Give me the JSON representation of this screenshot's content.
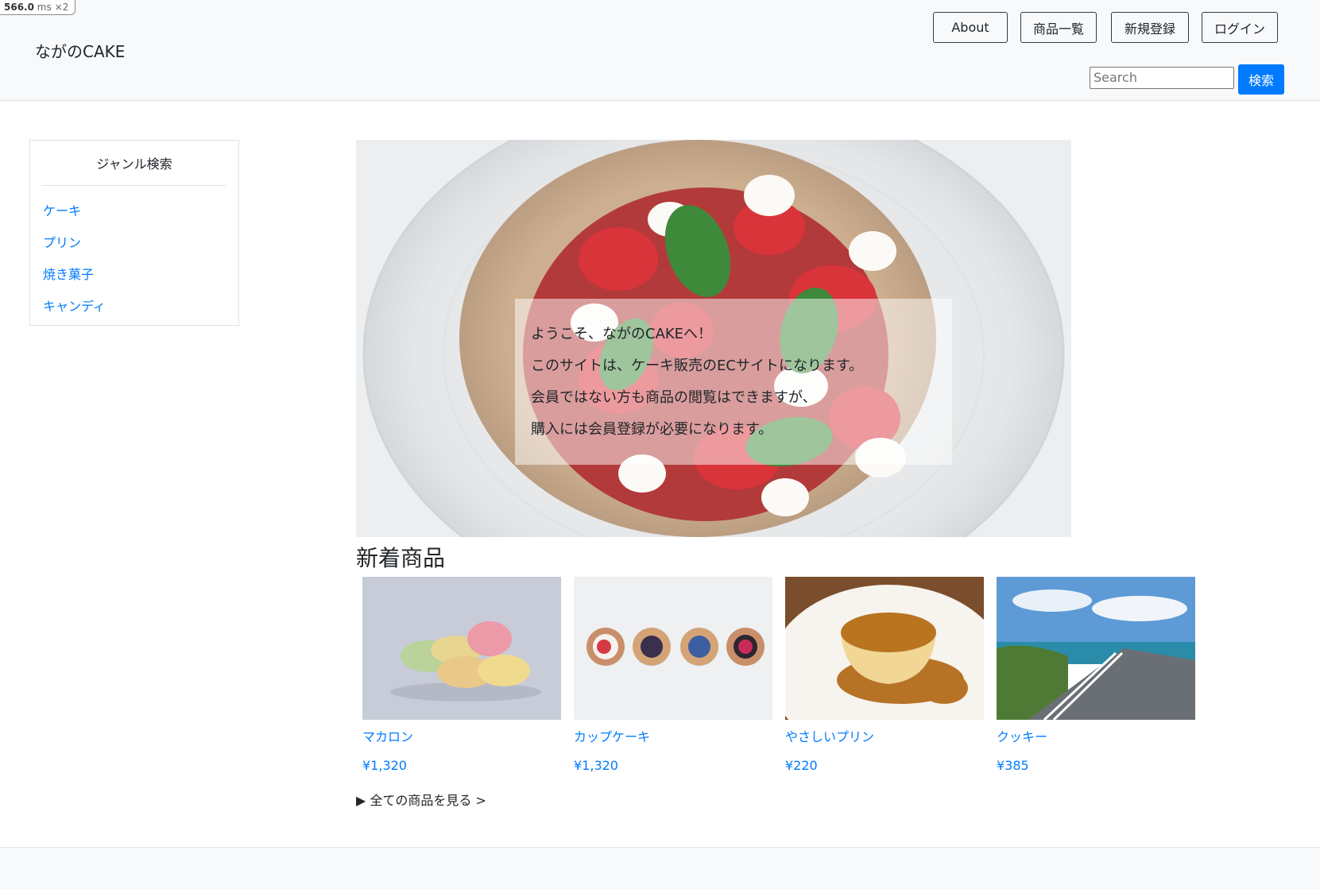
{
  "timing": {
    "value": "566.0",
    "unit": "ms",
    "multiplier": "×2"
  },
  "header": {
    "brand": "ながのCAKE",
    "nav": [
      "About",
      "商品一覧",
      "新規登録",
      "ログイン"
    ],
    "search": {
      "placeholder": "Search",
      "button": "検索"
    }
  },
  "sidebar": {
    "title": "ジャンル検索",
    "genres": [
      "ケーキ",
      "プリン",
      "焼き菓子",
      "キャンディ"
    ]
  },
  "hero": {
    "lines": [
      "ようこそ、ながのCAKEへ！",
      "このサイトは、ケーキ販売のECサイトになります。",
      "会員ではない方も商品の閲覧はできますが、",
      "購入には会員登録が必要になります。"
    ]
  },
  "new_products": {
    "title": "新着商品",
    "items": [
      {
        "name": "マカロン",
        "price": "¥1,320",
        "image": "macarons-photo"
      },
      {
        "name": "カップケーキ",
        "price": "¥1,320",
        "image": "tartlets-photo"
      },
      {
        "name": "やさしいプリン",
        "price": "¥220",
        "image": "pudding-photo"
      },
      {
        "name": "クッキー",
        "price": "¥385",
        "image": "coastal-road-photo"
      }
    ],
    "all_link": "全ての商品を見る >"
  },
  "colors": {
    "link": "#007bff",
    "primary_button": "#007bff",
    "header_bg": "#f8f9fa"
  }
}
